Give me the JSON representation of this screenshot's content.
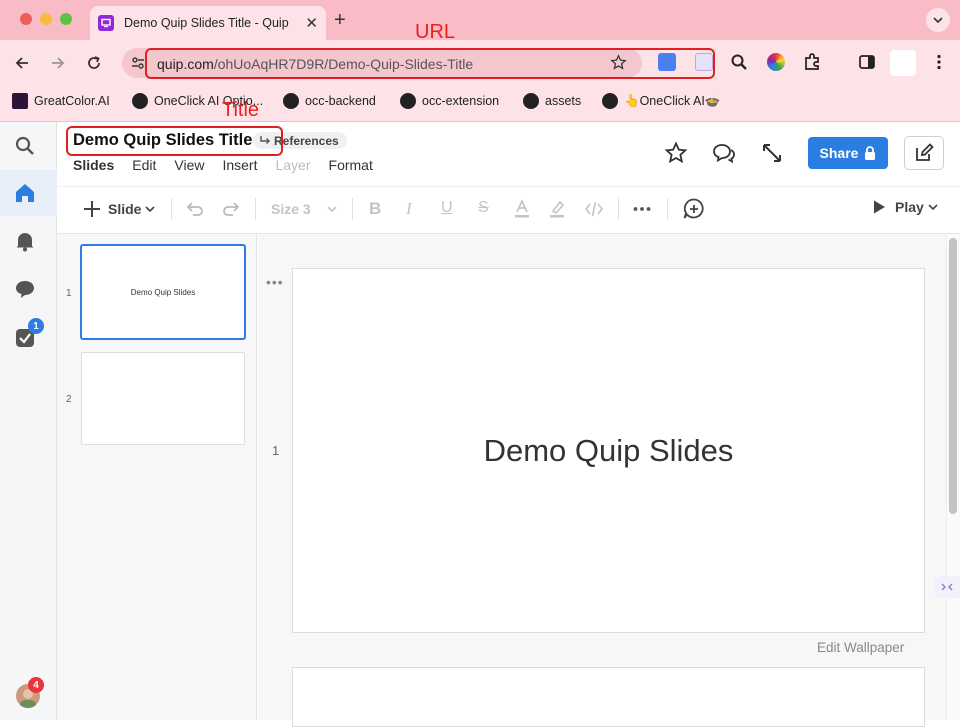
{
  "browser": {
    "tab_title": "Demo Quip Slides Title - Quip",
    "url_host": "quip.com",
    "url_path": "/ohUoAqHR7D9R/Demo-Quip-Slides-Title",
    "bookmarks": [
      "GreatColor.AI",
      "OneClick AI Optio...",
      "occ-backend",
      "occ-extension",
      "assets",
      "👆OneClick AI🍲"
    ]
  },
  "annotations": {
    "url_label": "URL",
    "title_label": "Title"
  },
  "quip": {
    "doc_title": "Demo Quip Slides Title",
    "references_label": "References",
    "menu": [
      "Slides",
      "Edit",
      "View",
      "Insert",
      "Layer",
      "Format"
    ],
    "share_label": "Share",
    "toolbar": {
      "slide_label": "Slide",
      "size_label": "Size 3",
      "play_label": "Play"
    },
    "left_nav": {
      "tasks_badge": "1",
      "avatar_badge": "4"
    },
    "slides": [
      {
        "number": "1",
        "thumb_text": "Demo Quip Slides",
        "text": "Demo Quip Slides"
      },
      {
        "number": "2",
        "thumb_text": "",
        "text": ""
      }
    ],
    "edit_wallpaper_label": "Edit Wallpaper"
  },
  "colors": {
    "browser_tint": "#f9bcc6",
    "accent_blue": "#2a7de1",
    "annotation_red": "#e02020",
    "badge_red": "#e8363c"
  }
}
